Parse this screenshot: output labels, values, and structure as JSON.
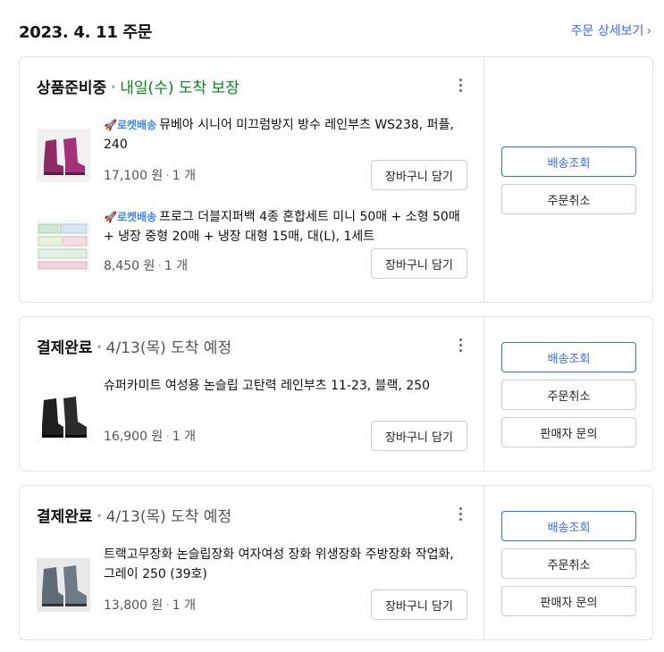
{
  "header": {
    "order_date": "2023. 4. 11 주문",
    "detail_link": "주문 상세보기",
    "detail_chevron": "›"
  },
  "orders": [
    {
      "status": "상품준비중",
      "delivery": "내일(수) 도착 보장",
      "delivery_color": "#00891a",
      "items": [
        {
          "rocket_badge": "로켓배송",
          "name": "뮤베아 시니어 미끄럼방지 방수 레인부츠 WS238, 퍼플, 240",
          "price": "17,100 원",
          "qty": "1 개",
          "cart_label": "장바구니 담기",
          "thumb_icon": "purple-rain-boots-image"
        },
        {
          "rocket_badge": "로켓배송",
          "name": "프로그 더블지퍼백 4종 혼합세트 미니 50매 + 소형 50매 + 냉장 중형 20매 + 냉장 대형 15매, 대(L), 1세트",
          "price": "8,450 원",
          "qty": "1 개",
          "cart_label": "장바구니 담기",
          "thumb_icon": "zipper-bag-set-image"
        }
      ],
      "actions": [
        "배송조회",
        "주문취소"
      ]
    },
    {
      "status": "결제완료",
      "delivery": "4/13(목) 도착 예정",
      "delivery_color": "#555555",
      "items": [
        {
          "rocket_badge": "",
          "name": "슈퍼카미트 여성용 논슬립 고탄력 레인부츠 11-23, 블랙, 250",
          "price": "16,900 원",
          "qty": "1 개",
          "cart_label": "장바구니 담기",
          "thumb_icon": "black-rain-boots-image"
        }
      ],
      "actions": [
        "배송조회",
        "주문취소",
        "판매자 문의"
      ]
    },
    {
      "status": "결제완료",
      "delivery": "4/13(목) 도착 예정",
      "delivery_color": "#555555",
      "items": [
        {
          "rocket_badge": "",
          "name": "트랙고무장화 논슬립장화 여자여성 장화 위생장화 주방장화 작업화, 그레이 250 (39호)",
          "price": "13,800 원",
          "qty": "1 개",
          "cart_label": "장바구니 담기",
          "thumb_icon": "gray-rain-boots-image"
        }
      ],
      "actions": [
        "배송조회",
        "주문취소",
        "판매자 문의"
      ]
    }
  ],
  "colors": {
    "accent": "#346aff",
    "guaranteed_green": "#00891a",
    "border": "#e4e4e4"
  }
}
